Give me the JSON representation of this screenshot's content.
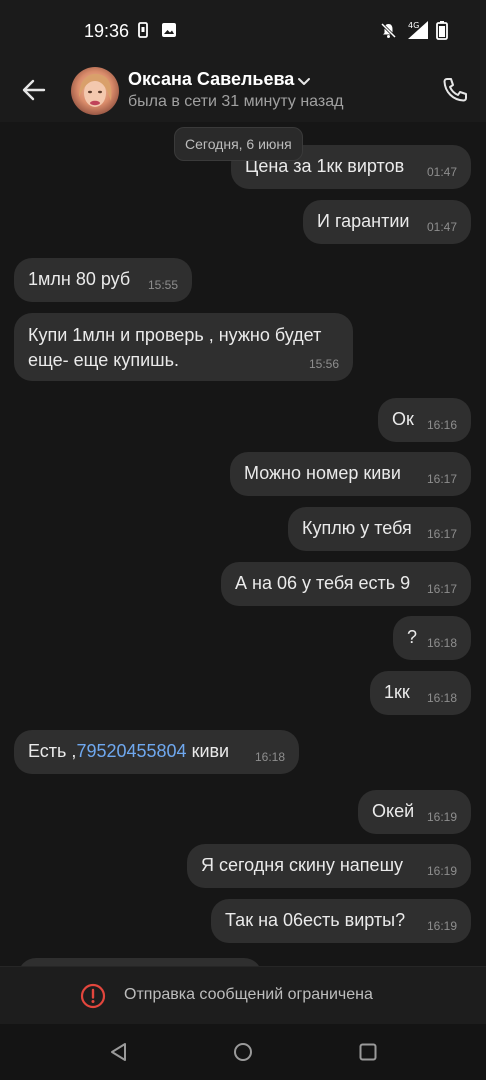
{
  "status_bar": {
    "time": "19:36",
    "network": "4G"
  },
  "header": {
    "contact_name": "Оксана Савельева",
    "contact_status": "была в сети 31 минуту назад"
  },
  "chat": {
    "date_label": "Сегодня, 6 июня",
    "messages": [
      {
        "side": "out",
        "text": "Цена за 1кк виртов",
        "time": "01:47"
      },
      {
        "side": "out",
        "text": "И гарантии",
        "time": "01:47"
      },
      {
        "side": "in",
        "text": "1млн 80 руб",
        "time": "15:55"
      },
      {
        "side": "in",
        "text": "Купи 1млн и проверь , нужно будет еще- еще купишь.",
        "time": "15:56"
      },
      {
        "side": "out",
        "text": "Ок",
        "time": "16:16"
      },
      {
        "side": "out",
        "text": "Можно номер киви",
        "time": "16:17"
      },
      {
        "side": "out",
        "text": "Куплю у тебя",
        "time": "16:17"
      },
      {
        "side": "out",
        "text": "А на 06 у тебя есть 9",
        "time": "16:17"
      },
      {
        "side": "out",
        "text": "?",
        "time": "16:18"
      },
      {
        "side": "out",
        "text": "1кк",
        "time": "16:18"
      },
      {
        "side": "in",
        "text_prefix": "Есть ,",
        "phone": "79520455804",
        "text_suffix": " киви",
        "time": "16:18"
      },
      {
        "side": "out",
        "text": "Окей",
        "time": "16:19"
      },
      {
        "side": "out",
        "text": "Я сегодня скину напешу",
        "time": "16:19"
      },
      {
        "side": "out",
        "text": "Так на 06есть вирты?",
        "time": "16:19"
      }
    ]
  },
  "restriction": {
    "text": "Отправка сообщений ограничена"
  },
  "icons": {
    "back": "arrow-left-icon",
    "call": "phone-icon",
    "dropdown": "chevron-down-icon",
    "warning": "alert-circle-icon",
    "nav_back": "triangle-back-icon",
    "nav_home": "circle-home-icon",
    "nav_recents": "square-recents-icon"
  },
  "colors": {
    "background": "#161616",
    "bubble": "#2f2f2f",
    "link": "#6fa8ef",
    "warning": "#e3463d"
  }
}
